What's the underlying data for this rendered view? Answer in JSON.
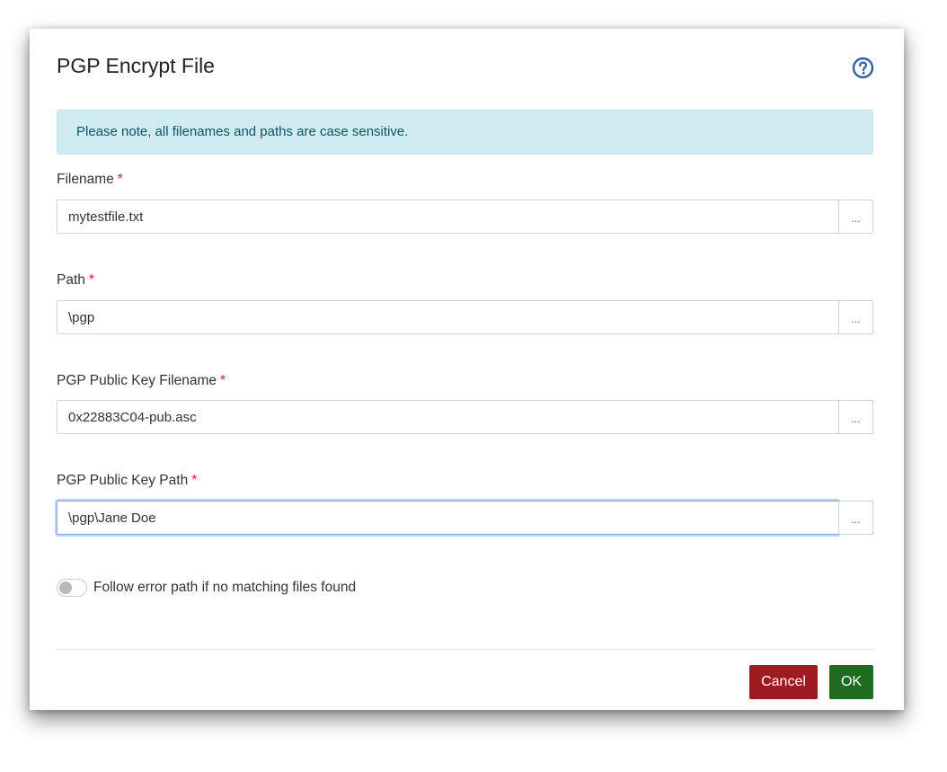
{
  "dialog": {
    "title": "PGP Encrypt File",
    "help_icon": "help-circle-icon"
  },
  "alert": {
    "text": "Please note, all filenames and paths are case sensitive."
  },
  "fields": [
    {
      "label": "Filename",
      "required_mark": "*",
      "value": "mytestfile.txt",
      "browse_label": "..."
    },
    {
      "label": "Path",
      "required_mark": "*",
      "value": "\\pgp",
      "browse_label": "..."
    },
    {
      "label": "PGP Public Key Filename",
      "required_mark": "*",
      "value": "0x22883C04-pub.asc",
      "browse_label": "..."
    },
    {
      "label": "PGP Public Key Path",
      "required_mark": "*",
      "value": "\\pgp\\Jane Doe",
      "browse_label": "..."
    }
  ],
  "toggle": {
    "label": "Follow error path if no matching files found",
    "checked": false
  },
  "footer": {
    "cancel_label": "Cancel",
    "ok_label": "OK"
  },
  "colors": {
    "cancel": "#9e1b21",
    "ok": "#1f6b1f",
    "help_icon": "#2f5ea8",
    "alert_bg": "#d1ecf1",
    "required": "#e01b1b"
  }
}
